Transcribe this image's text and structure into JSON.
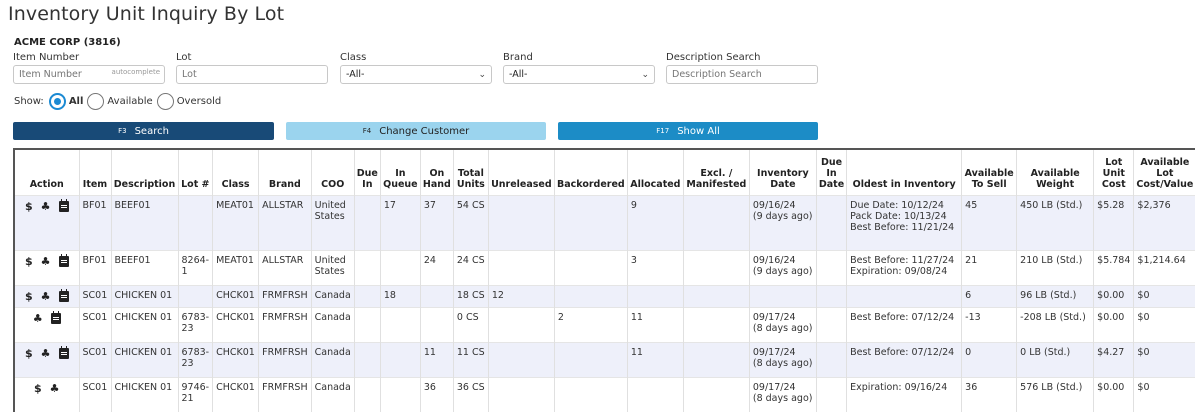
{
  "page": {
    "title": "Inventory Unit Inquiry By Lot",
    "company": "ACME CORP (3816)"
  },
  "filters": {
    "item_number": {
      "label": "Item Number",
      "placeholder": "Item Number",
      "hint": "autocomplete"
    },
    "lot": {
      "label": "Lot",
      "placeholder": "Lot"
    },
    "class": {
      "label": "Class",
      "value": "-All-"
    },
    "brand": {
      "label": "Brand",
      "value": "-All-"
    },
    "description": {
      "label": "Description Search",
      "placeholder": "Description Search"
    }
  },
  "show": {
    "label": "Show:",
    "options": [
      {
        "label": "All",
        "selected": true
      },
      {
        "label": "Available",
        "selected": false
      },
      {
        "label": "Oversold",
        "selected": false
      }
    ]
  },
  "buttons": {
    "search": {
      "key": "F3",
      "label": "Search"
    },
    "change_customer": {
      "key": "F4",
      "label": "Change Customer"
    },
    "show_all": {
      "key": "F17",
      "label": "Show All"
    }
  },
  "table": {
    "headers": {
      "action": "Action",
      "item": "Item",
      "description": "Description",
      "lot": "Lot #",
      "class": "Class",
      "brand": "Brand",
      "coo": "COO",
      "due_in": "Due In",
      "in_queue": "In Queue",
      "on_hand": "On Hand",
      "total_units": "Total Units",
      "unreleased": "Unreleased",
      "backordered": "Backordered",
      "allocated": "Allocated",
      "excl": "Excl. / Manifested",
      "inventory_date": "Inventory Date",
      "due_in_date": "Due In Date",
      "oldest": "Oldest in Inventory",
      "available_to_sell": "Available To Sell",
      "available_weight": "Available Weight",
      "lot_unit_cost": "Lot Unit Cost",
      "lot_value": "Available Lot Cost/Value"
    },
    "rows": [
      {
        "icons": [
          "dollar-icon",
          "pallets-icon",
          "calendar-icon"
        ],
        "item": "BF01",
        "description": "BEEF01",
        "lot": "",
        "class": "MEAT01",
        "brand": "ALLSTAR",
        "coo": "United States",
        "due_in": "",
        "in_queue": "17",
        "on_hand": "37",
        "total_units": "54 CS",
        "unreleased": "",
        "backordered": "",
        "allocated": "9",
        "excl": "",
        "inventory_date": "09/16/24",
        "inventory_ago": "(9 days ago)",
        "due_in_date": "",
        "oldest": [
          "Due Date: 10/12/24",
          "Pack Date: 10/13/24",
          "Best Before: 11/21/24"
        ],
        "available_to_sell": "45",
        "available_weight": "450 LB (Std.)",
        "lot_unit_cost": "$5.28",
        "lot_value": "$2,376",
        "negative": false
      },
      {
        "icons": [
          "dollar-icon",
          "pallets-icon",
          "calendar-icon"
        ],
        "item": "BF01",
        "description": "BEEF01",
        "lot": "8264-1",
        "class": "MEAT01",
        "brand": "ALLSTAR",
        "coo": "United States",
        "due_in": "",
        "in_queue": "",
        "on_hand": "24",
        "total_units": "24 CS",
        "unreleased": "",
        "backordered": "",
        "allocated": "3",
        "excl": "",
        "inventory_date": "09/16/24",
        "inventory_ago": "(9 days ago)",
        "due_in_date": "",
        "oldest": [
          "Best Before: 11/27/24",
          "Expiration: 09/08/24"
        ],
        "available_to_sell": "21",
        "available_weight": "210 LB (Std.)",
        "lot_unit_cost": "$5.784",
        "lot_value": "$1,214.64",
        "negative": false
      },
      {
        "icons": [
          "dollar-icon",
          "pallets-icon",
          "calendar-icon"
        ],
        "item": "SC01",
        "description": "CHICKEN 01",
        "lot": "",
        "class": "CHCK01",
        "brand": "FRMFRSH",
        "coo": "Canada",
        "due_in": "",
        "in_queue": "18",
        "on_hand": "",
        "total_units": "18 CS",
        "unreleased": "12",
        "backordered": "",
        "allocated": "",
        "excl": "",
        "inventory_date": "",
        "inventory_ago": "",
        "due_in_date": "",
        "oldest": [],
        "available_to_sell": "6",
        "available_weight": "96 LB (Std.)",
        "lot_unit_cost": "$0.00",
        "lot_value": "$0",
        "negative": false
      },
      {
        "icons": [
          "pallets-icon",
          "calendar-icon"
        ],
        "item": "SC01",
        "description": "CHICKEN 01",
        "lot": "6783-23",
        "class": "CHCK01",
        "brand": "FRMFRSH",
        "coo": "Canada",
        "due_in": "",
        "in_queue": "",
        "on_hand": "",
        "total_units": "0 CS",
        "unreleased": "",
        "backordered": "2",
        "allocated": "11",
        "excl": "",
        "inventory_date": "09/17/24",
        "inventory_ago": "(8 days ago)",
        "due_in_date": "",
        "oldest": [
          "Best Before: 07/12/24"
        ],
        "available_to_sell": "-13",
        "available_weight": "-208 LB (Std.)",
        "lot_unit_cost": "$0.00",
        "lot_value": "$0",
        "negative": true
      },
      {
        "icons": [
          "dollar-icon",
          "pallets-icon",
          "calendar-icon"
        ],
        "item": "SC01",
        "description": "CHICKEN 01",
        "lot": "6783-23",
        "class": "CHCK01",
        "brand": "FRMFRSH",
        "coo": "Canada",
        "due_in": "",
        "in_queue": "",
        "on_hand": "11",
        "total_units": "11 CS",
        "unreleased": "",
        "backordered": "",
        "allocated": "11",
        "excl": "",
        "inventory_date": "09/17/24",
        "inventory_ago": "(8 days ago)",
        "due_in_date": "",
        "oldest": [
          "Best Before: 07/12/24"
        ],
        "available_to_sell": "0",
        "available_weight": "0 LB (Std.)",
        "lot_unit_cost": "$4.27",
        "lot_value": "$0",
        "negative": false
      },
      {
        "icons": [
          "dollar-icon",
          "pallets-icon"
        ],
        "item": "SC01",
        "description": "CHICKEN 01",
        "lot": "9746-21",
        "class": "CHCK01",
        "brand": "FRMFRSH",
        "coo": "Canada",
        "due_in": "",
        "in_queue": "",
        "on_hand": "36",
        "total_units": "36 CS",
        "unreleased": "",
        "backordered": "",
        "allocated": "",
        "excl": "",
        "inventory_date": "09/17/24",
        "inventory_ago": "(8 days ago)",
        "due_in_date": "",
        "oldest": [
          "Expiration: 09/16/24"
        ],
        "available_to_sell": "36",
        "available_weight": "576 LB (Std.)",
        "lot_unit_cost": "$0.00",
        "lot_value": "$0",
        "negative": false
      }
    ]
  }
}
